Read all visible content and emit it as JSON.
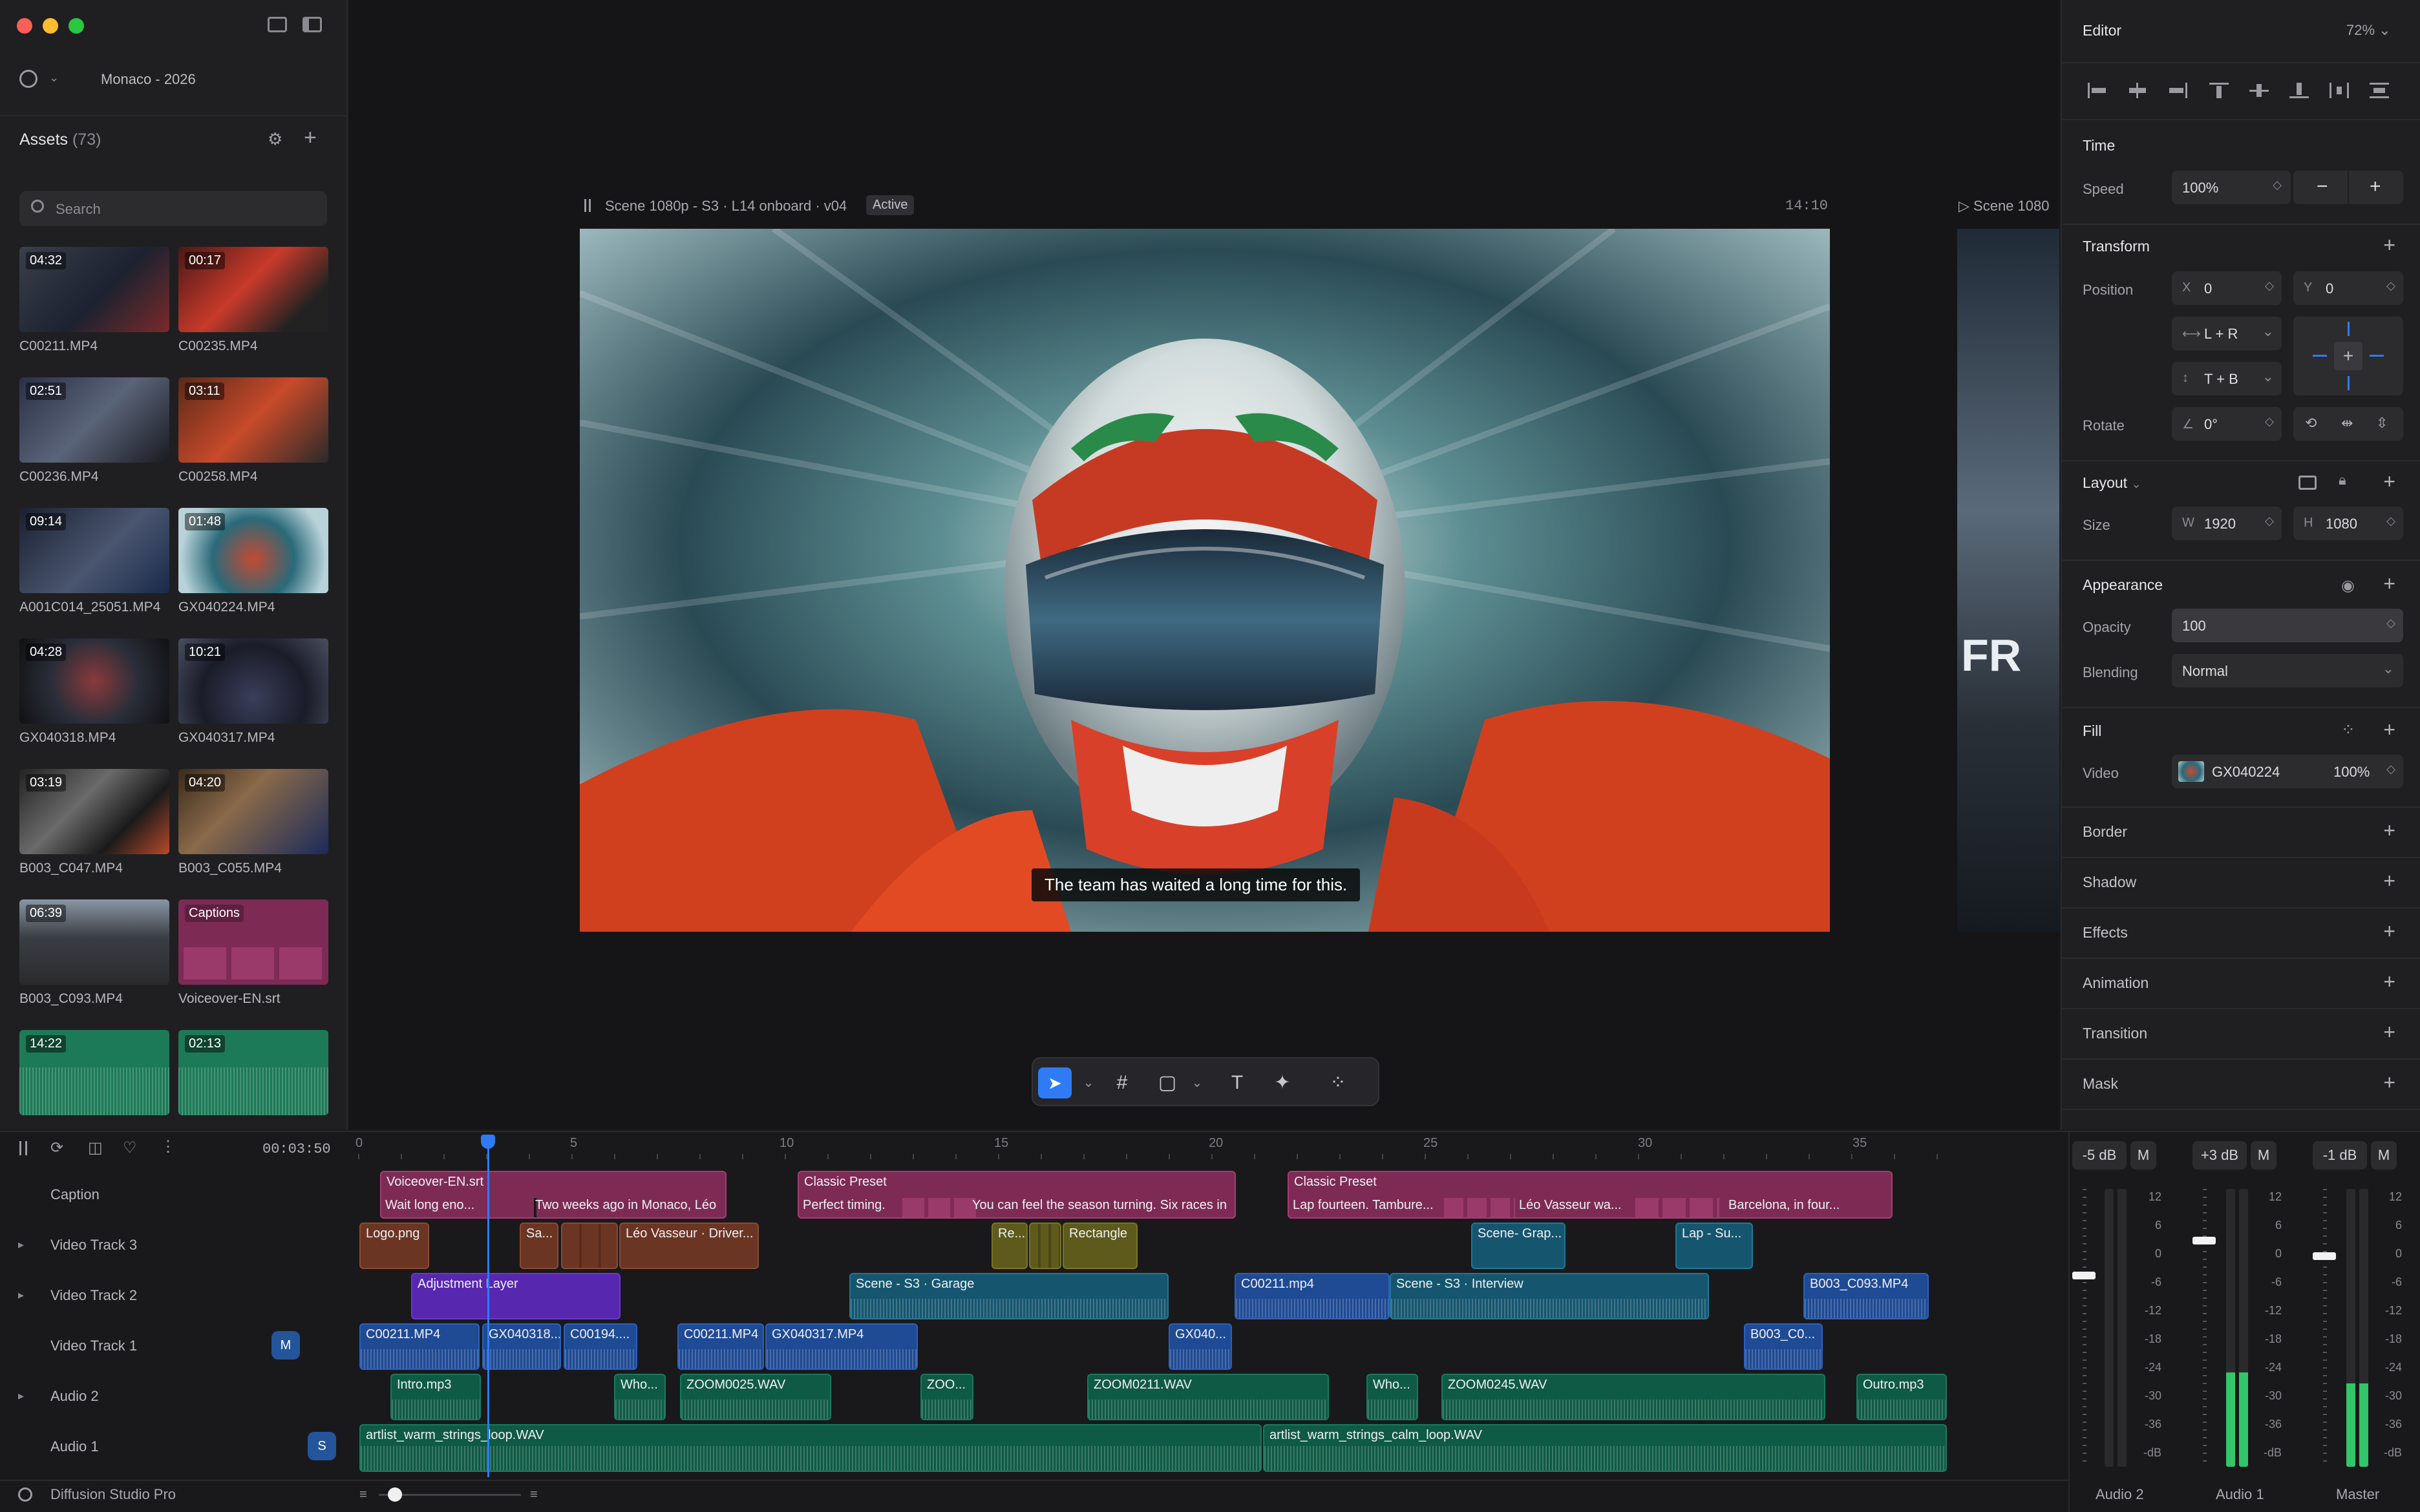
{
  "project": {
    "name": "Monaco - 2026"
  },
  "app": {
    "name": "Diffusion Studio Pro"
  },
  "assets": {
    "title": "Assets",
    "count": "(73)",
    "search_placeholder": "Search",
    "items": [
      {
        "name": "C00211.MP4",
        "duration": "04:32"
      },
      {
        "name": "C00235.MP4",
        "duration": "00:17"
      },
      {
        "name": "C00236.MP4",
        "duration": "02:51"
      },
      {
        "name": "C00258.MP4",
        "duration": "03:11"
      },
      {
        "name": "A001C014_25051.MP4",
        "duration": "09:14"
      },
      {
        "name": "GX040224.MP4",
        "duration": "01:48"
      },
      {
        "name": "GX040318.MP4",
        "duration": "04:28"
      },
      {
        "name": "GX040317.MP4",
        "duration": "10:21"
      },
      {
        "name": "B003_C047.MP4",
        "duration": "03:19"
      },
      {
        "name": "B003_C055.MP4",
        "duration": "04:20"
      },
      {
        "name": "B003_C093.MP4",
        "duration": "06:39"
      },
      {
        "name": "Voiceover-EN.srt",
        "duration": "Captions"
      },
      {
        "name": "",
        "duration": "14:22"
      },
      {
        "name": "",
        "duration": "02:13"
      }
    ]
  },
  "preview": {
    "scene_title": "Scene 1080p - S3 · L14 onboard · v04",
    "status": "Active",
    "timecode": "14:10",
    "subtitle": "The team has waited a long time for this.",
    "next_scene": "Scene 1080"
  },
  "editor": {
    "title": "Editor",
    "zoom": "72%",
    "time": {
      "heading": "Time",
      "speed_label": "Speed",
      "speed": "100%",
      "minus": "−",
      "plus": "+"
    },
    "transform": {
      "heading": "Transform",
      "position_label": "Position",
      "x_key": "X",
      "x": "0",
      "y_key": "Y",
      "y": "0",
      "h_constraint": "L + R",
      "v_constraint": "T + B",
      "rotate_label": "Rotate",
      "rotate": "0°"
    },
    "layout": {
      "heading": "Layout",
      "size_label": "Size",
      "w_key": "W",
      "w": "1920",
      "h_key": "H",
      "h": "1080"
    },
    "appearance": {
      "heading": "Appearance",
      "opacity_label": "Opacity",
      "opacity": "100",
      "blending_label": "Blending",
      "blending": "Normal"
    },
    "fill": {
      "heading": "Fill",
      "video_label": "Video",
      "source": "GX040224",
      "percent": "100%"
    },
    "sections": [
      "Border",
      "Shadow",
      "Effects",
      "Animation",
      "Transition",
      "Mask"
    ]
  },
  "timeline": {
    "timecode": "00:03:50",
    "ruler": [
      "0",
      "5",
      "10",
      "15",
      "20",
      "25",
      "30",
      "35"
    ],
    "tracks": [
      {
        "name": "Caption"
      },
      {
        "name": "Video Track 3"
      },
      {
        "name": "Video Track 2"
      },
      {
        "name": "Video Track 1",
        "badge": "M"
      },
      {
        "name": "Audio 2"
      },
      {
        "name": "Audio 1",
        "badge": "S"
      }
    ],
    "clips": {
      "voiceover": "Voiceover-EN.srt",
      "cap1": "Wait long eno...",
      "cap2": "Two weeks ago in Monaco, Léo",
      "classic1": "Classic Preset",
      "cap3": "Perfect timing.",
      "cap4": "You can feel the season turning. Six races in",
      "classic2": "Classic Preset",
      "cap5": "Lap fourteen. Tambure...",
      "cap6": "Léo Vasseur wa...",
      "cap7": "Barcelona, in four...",
      "logo": "Logo.png",
      "sa": "Sa...",
      "leo": "Léo Vasseur · Driver...",
      "re": "Re...",
      "rect": "Rectangle",
      "scenegrap": "Scene- Grap...",
      "lapsu": "Lap - Su...",
      "adjust": "Adjustment Layer",
      "garage": "Scene - S3 · Garage",
      "c211b": "C00211.mp4",
      "interview": "Scene - S3 · Interview",
      "b093": "B003_C093.MP4",
      "c211": "C00211.MP4",
      "gx318": "GX040318...",
      "c194": "C00194....",
      "c211c": "C00211.MP4",
      "gx317": "GX040317.MP4",
      "gx0": "GX040...",
      "b003c": "B003_C0...",
      "intro": "Intro.mp3",
      "who1": "Who...",
      "zoom25": "ZOOM0025.WAV",
      "zoo": "ZOO...",
      "zoom211": "ZOOM0211.WAV",
      "who2": "Who...",
      "zoom245": "ZOOM0245.WAV",
      "outro": "Outro.mp3",
      "strings1": "artlist_warm_strings_loop.WAV",
      "strings2": "artlist_warm_strings_calm_loop.WAV"
    }
  },
  "mixer": {
    "channels": [
      {
        "name": "Audio 2",
        "gain": "-5 dB",
        "mute": "M",
        "level": 0.0
      },
      {
        "name": "Audio 1",
        "gain": "+3 dB",
        "mute": "M",
        "level": 0.34
      },
      {
        "name": "Master",
        "gain": "-1 dB",
        "mute": "M",
        "level": 0.3
      }
    ],
    "scale": [
      "12",
      "6",
      "0",
      "-6",
      "-12",
      "-18",
      "-24",
      "-30",
      "-36",
      "-dB"
    ]
  },
  "colors": {
    "accent": "#2f7bf5",
    "caption": "#7d2b55",
    "audio": "#0f5a44",
    "video": "#1f4a94"
  }
}
